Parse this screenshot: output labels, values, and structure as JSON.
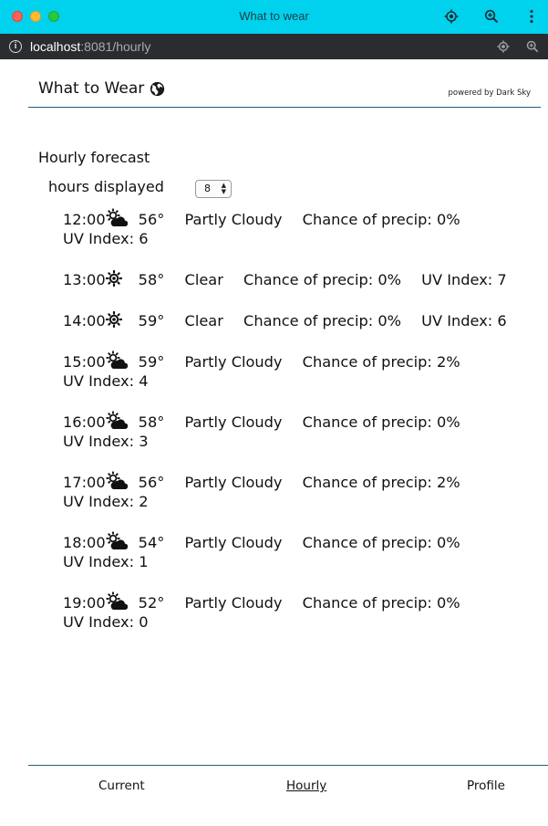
{
  "window": {
    "title": "What to wear",
    "url_host": "localhost",
    "url_rest": ":8081/hourly"
  },
  "header": {
    "title": "What to Wear",
    "powered_by": "powered by Dark Sky"
  },
  "forecast": {
    "title": "Hourly forecast",
    "hours_label": "hours displayed",
    "hours_value": "8",
    "hours": [
      {
        "time": "12:00",
        "icon": "partly-cloudy-icon",
        "temp": "56°",
        "summary": "Partly Cloudy",
        "precip": "Chance of precip: 0%",
        "uv": "UV Index: 6"
      },
      {
        "time": "13:00",
        "icon": "sun-icon",
        "temp": "58°",
        "summary": "Clear",
        "precip": "Chance of precip: 0%",
        "uv": "UV Index: 7"
      },
      {
        "time": "14:00",
        "icon": "sun-icon",
        "temp": "59°",
        "summary": "Clear",
        "precip": "Chance of precip: 0%",
        "uv": "UV Index: 6"
      },
      {
        "time": "15:00",
        "icon": "partly-cloudy-icon",
        "temp": "59°",
        "summary": "Partly Cloudy",
        "precip": "Chance of precip: 2%",
        "uv": "UV Index: 4"
      },
      {
        "time": "16:00",
        "icon": "partly-cloudy-icon",
        "temp": "58°",
        "summary": "Partly Cloudy",
        "precip": "Chance of precip: 0%",
        "uv": "UV Index: 3"
      },
      {
        "time": "17:00",
        "icon": "partly-cloudy-icon",
        "temp": "56°",
        "summary": "Partly Cloudy",
        "precip": "Chance of precip: 2%",
        "uv": "UV Index: 2"
      },
      {
        "time": "18:00",
        "icon": "partly-cloudy-icon",
        "temp": "54°",
        "summary": "Partly Cloudy",
        "precip": "Chance of precip: 0%",
        "uv": "UV Index: 1"
      },
      {
        "time": "19:00",
        "icon": "partly-cloudy-icon",
        "temp": "52°",
        "summary": "Partly Cloudy",
        "precip": "Chance of precip: 0%",
        "uv": "UV Index: 0"
      }
    ]
  },
  "nav": {
    "current": "Current",
    "hourly": "Hourly",
    "profile": "Profile"
  },
  "colors": {
    "titlebar": "#00d2ee",
    "urlbar": "#2a2c2f",
    "rule": "#1f5c7a"
  }
}
